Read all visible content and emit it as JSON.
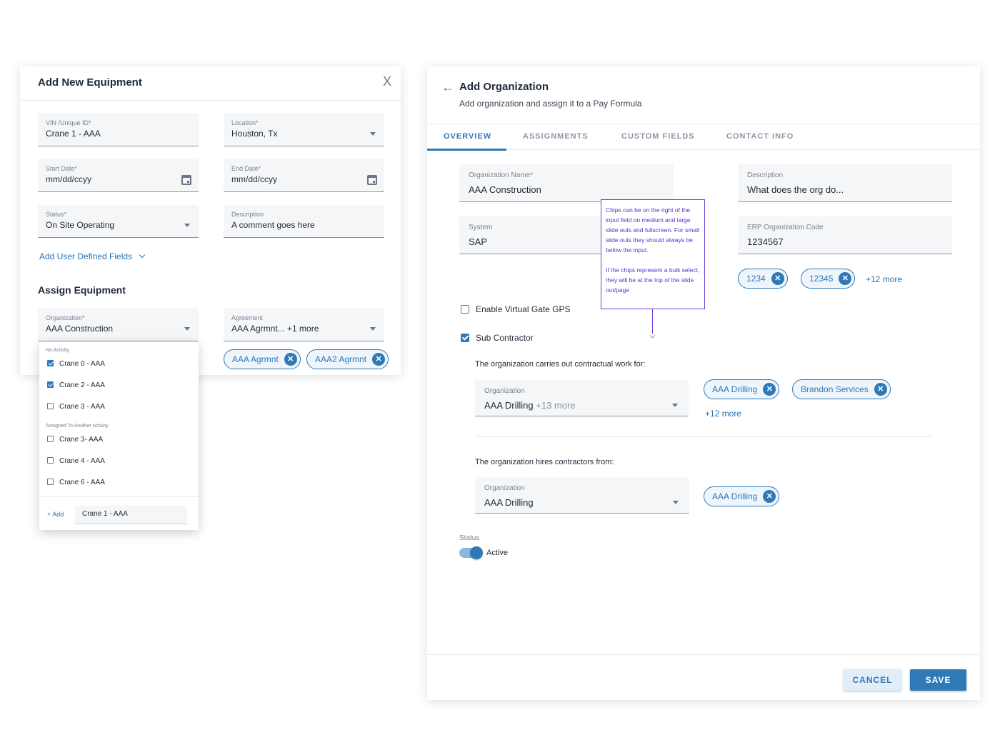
{
  "equipment_panel": {
    "title": "Add New Equipment",
    "close_icon": "X",
    "fields": {
      "vin": {
        "label": "VIN /Unique ID*",
        "value": "Crane 1 - AAA"
      },
      "location": {
        "label": "Location*",
        "value": "Houston, Tx"
      },
      "start_date": {
        "label": "Start Date*",
        "value": "mm/dd/ccyy"
      },
      "end_date": {
        "label": "End Date*",
        "value": "mm/dd/ccyy"
      },
      "status": {
        "label": "Status*",
        "value": "On Site Operating"
      },
      "description": {
        "label": "Description",
        "value": "A comment goes here"
      }
    },
    "add_user_fields": "Add User Defined Fields",
    "assign_title": "Assign Equipment",
    "organization": {
      "label": "Organization*",
      "value": "AAA Construction"
    },
    "agreement": {
      "label": "Agreement",
      "value": "AAA Agrmnt... +1 more"
    },
    "chips": [
      "AAA Agrmnt",
      "AAA2 Agrmnt"
    ],
    "dropdown": {
      "group1": "No Activity",
      "group1_items": [
        {
          "label": "Crane 0 - AAA",
          "checked": true
        },
        {
          "label": "Crane 2 - AAA",
          "checked": true
        },
        {
          "label": "Crane 3 - AAA",
          "checked": false
        }
      ],
      "group2": "Assigned To Another Activity",
      "group2_items": [
        {
          "label": "Crane 3- AAA",
          "checked": false
        },
        {
          "label": "Crane 4 - AAA",
          "checked": false
        },
        {
          "label": "Crane 6 - AAA",
          "checked": false
        }
      ],
      "add_label": "+ Add",
      "add_value": "Crane 1 - AAA"
    }
  },
  "org_panel": {
    "back_icon": "←",
    "title": "Add Organization",
    "subtitle": "Add organization and assign it to a Pay Formula",
    "tabs": [
      "OVERVIEW",
      "ASSIGNMENTS",
      "CUSTOM FIELDS",
      "CONTACT INFO"
    ],
    "active_tab": "OVERVIEW",
    "org_name": {
      "label": "Organization Name*",
      "value": "AAA Construction"
    },
    "description": {
      "label": "Description",
      "value": "What does the org do..."
    },
    "system": {
      "label": "System",
      "value": "SAP"
    },
    "erp_code": {
      "label": "ERP Organization Code",
      "value": "1234567"
    },
    "erp_chips": [
      "1234",
      "12345"
    ],
    "erp_more": "+12 more",
    "note_p1": "Chips can be on the right of the input field on medium and large slide outs and fullscreen. For small slide outs they should always be below the input.",
    "note_p2": "If the chips represent a bulk select, they will be at the top of the slide out/page",
    "enable_gps": "Enable Virtual Gate GPS",
    "sub_contractor": "Sub Contractor",
    "contract_for_text": "The organization carries out contractual work for:",
    "contract_for_field": {
      "label": "Organization",
      "value": "AAA Drilling",
      "more": "+13 more"
    },
    "contract_for_chips": [
      "AAA Drilling",
      "Brandon Services"
    ],
    "contract_for_more": "+12 more",
    "hires_text": "The organization hires contractors from:",
    "hires_field": {
      "label": "Organization",
      "value": "AAA Drilling"
    },
    "hires_chips": [
      "AAA Drilling"
    ],
    "status_label": "Status",
    "status_value": "Active",
    "cancel": "CANCEL",
    "save": "SAVE"
  },
  "colors": {
    "accent": "#2f79b8",
    "note": "#6a3ddc"
  }
}
